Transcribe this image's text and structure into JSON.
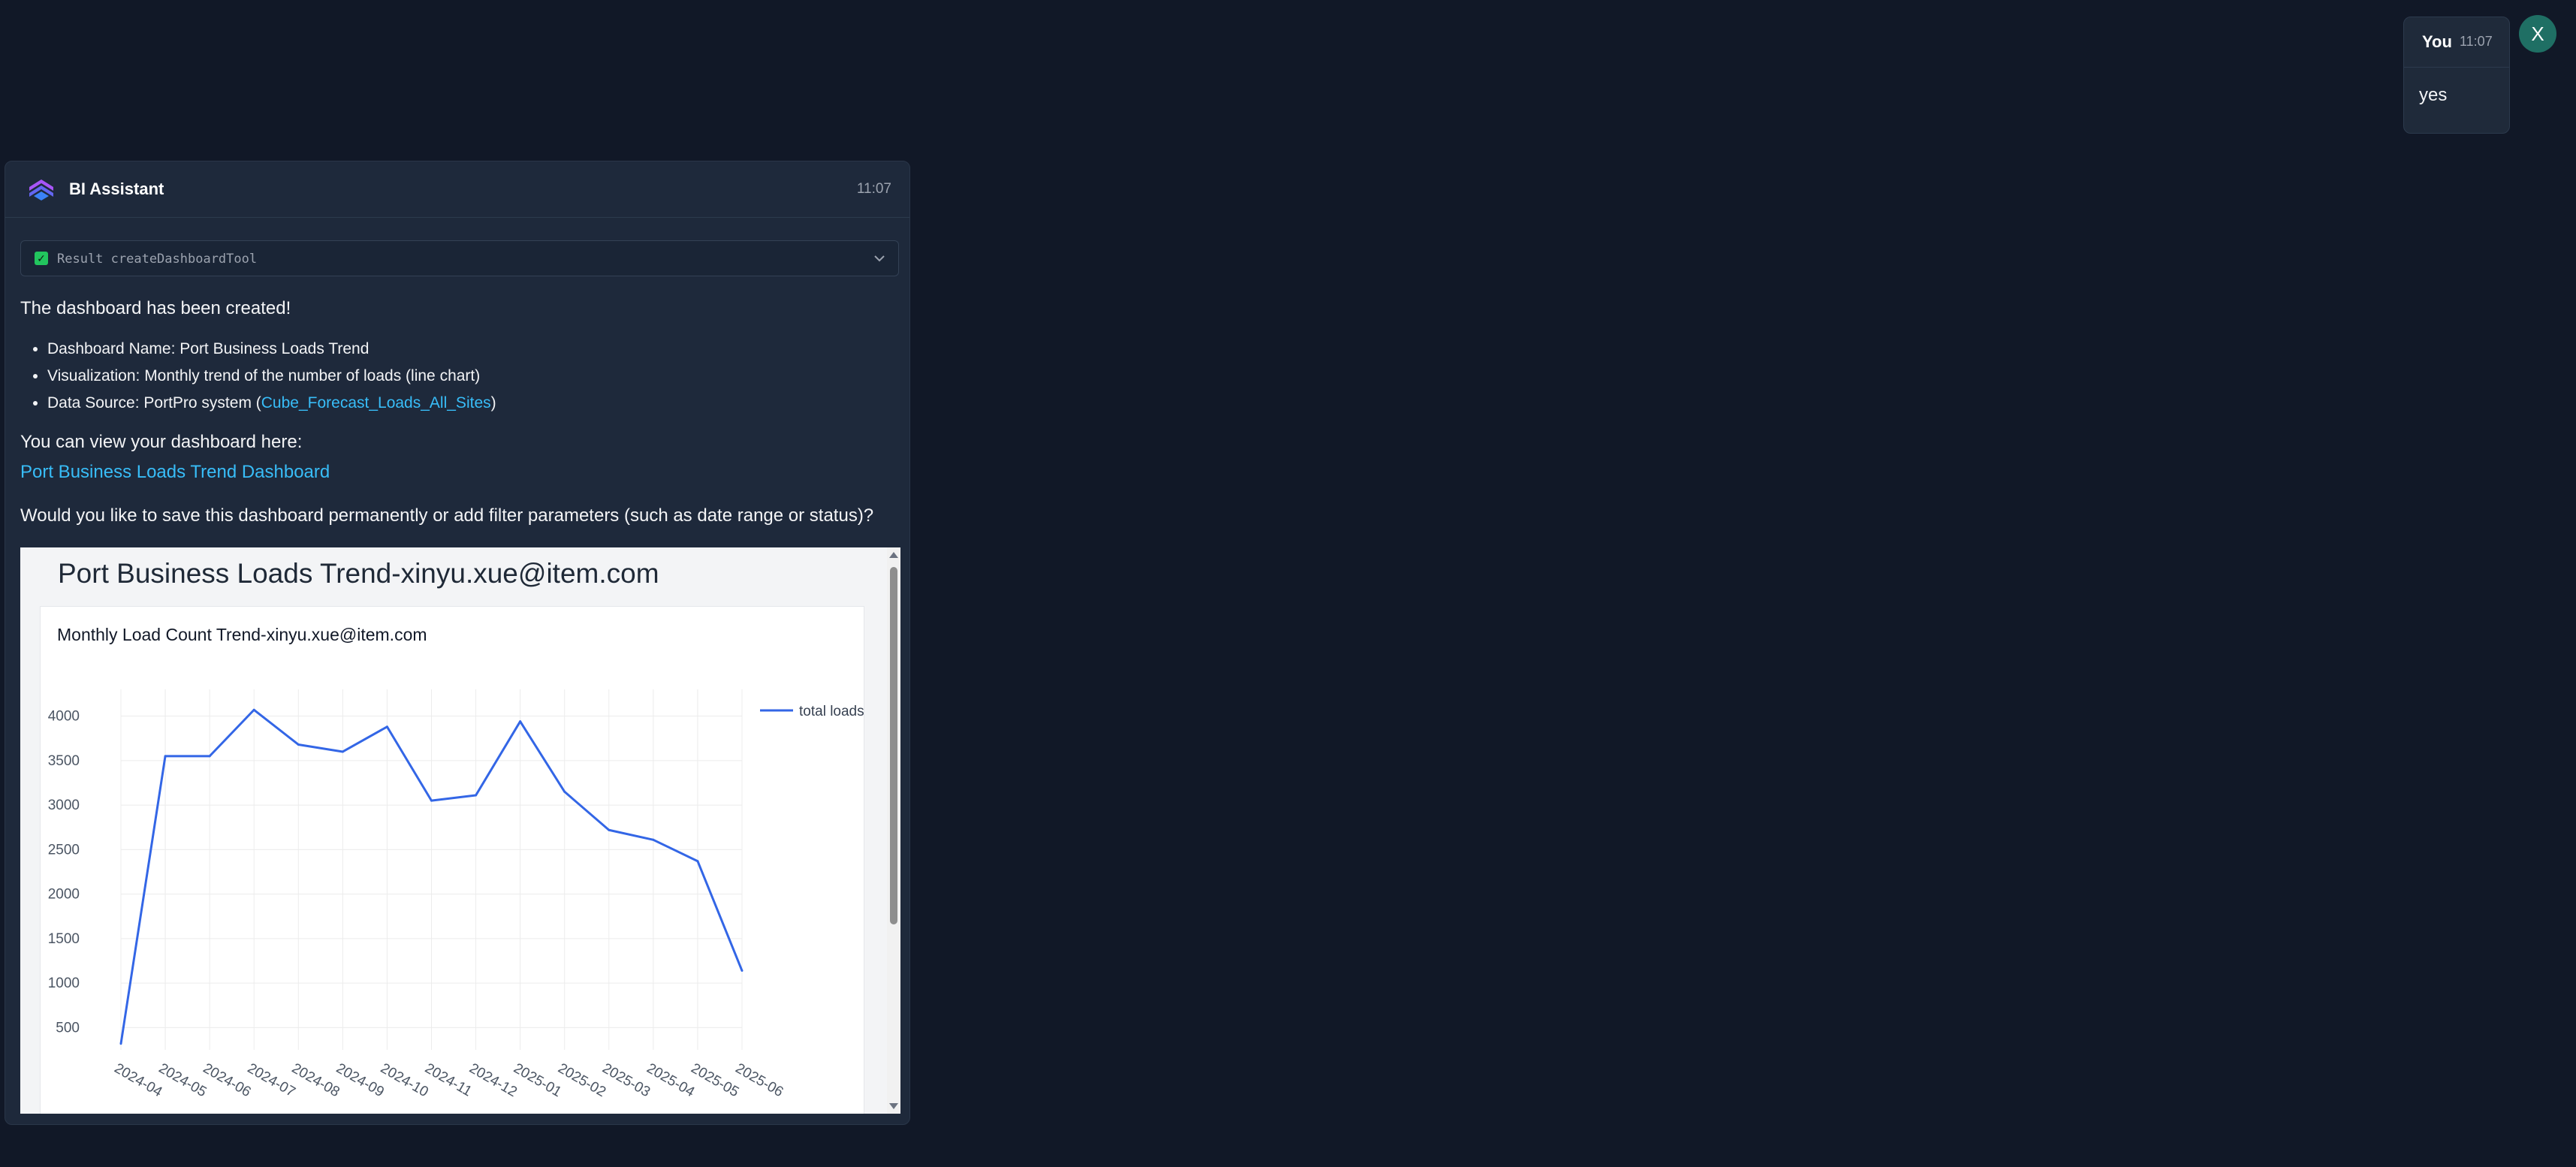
{
  "user_message": {
    "author": "You",
    "time": "11:07",
    "text": "yes",
    "avatar_letter": "X"
  },
  "assistant": {
    "name": "BI Assistant",
    "time": "11:07",
    "tool_result": {
      "label": "Result createDashboardTool",
      "status_icon": "check-icon",
      "expand_icon": "chevron-down-icon"
    },
    "created_text": "The dashboard has been created!",
    "bullets": {
      "name": "Dashboard Name: Port Business Loads Trend",
      "visualization": "Visualization: Monthly trend of the number of loads (line chart)",
      "source_prefix": "Data Source: PortPro system (",
      "source_link": "Cube_Forecast_Loads_All_Sites",
      "source_suffix": ")"
    },
    "view_text": "You can view your dashboard here:",
    "dashboard_link": "Port Business Loads Trend Dashboard",
    "question": "Would you like to save this dashboard permanently or add filter parameters (such as date range or status)?"
  },
  "dashboard": {
    "title": "Port Business Loads Trend-xinyu.xue@item.com",
    "chart_title": "Monthly Load Count Trend-xinyu.xue@item.com"
  },
  "chart_data": {
    "type": "line",
    "title": "Monthly Load Count Trend-xinyu.xue@item.com",
    "x": [
      "2024-04",
      "2024-05",
      "2024-06",
      "2024-07",
      "2024-08",
      "2024-09",
      "2024-10",
      "2024-11",
      "2024-12",
      "2025-01",
      "2025-02",
      "2025-03",
      "2025-04",
      "2025-05",
      "2025-06"
    ],
    "series": [
      {
        "name": "total loads",
        "color": "#3366e6",
        "values": [
          320,
          3550,
          3550,
          4070,
          3680,
          3600,
          3880,
          3050,
          3110,
          3940,
          3150,
          2720,
          2610,
          2370,
          1140
        ]
      }
    ],
    "yticks": [
      500,
      1000,
      1500,
      2000,
      2500,
      3000,
      3500,
      4000
    ],
    "ylim": [
      250,
      4300
    ],
    "grid": true,
    "legend": "top-right"
  },
  "colors": {
    "background": "#111827",
    "card": "#1e293b",
    "link": "#38bdf8",
    "line": "#3366e6",
    "avatar": "#1f6f64"
  }
}
